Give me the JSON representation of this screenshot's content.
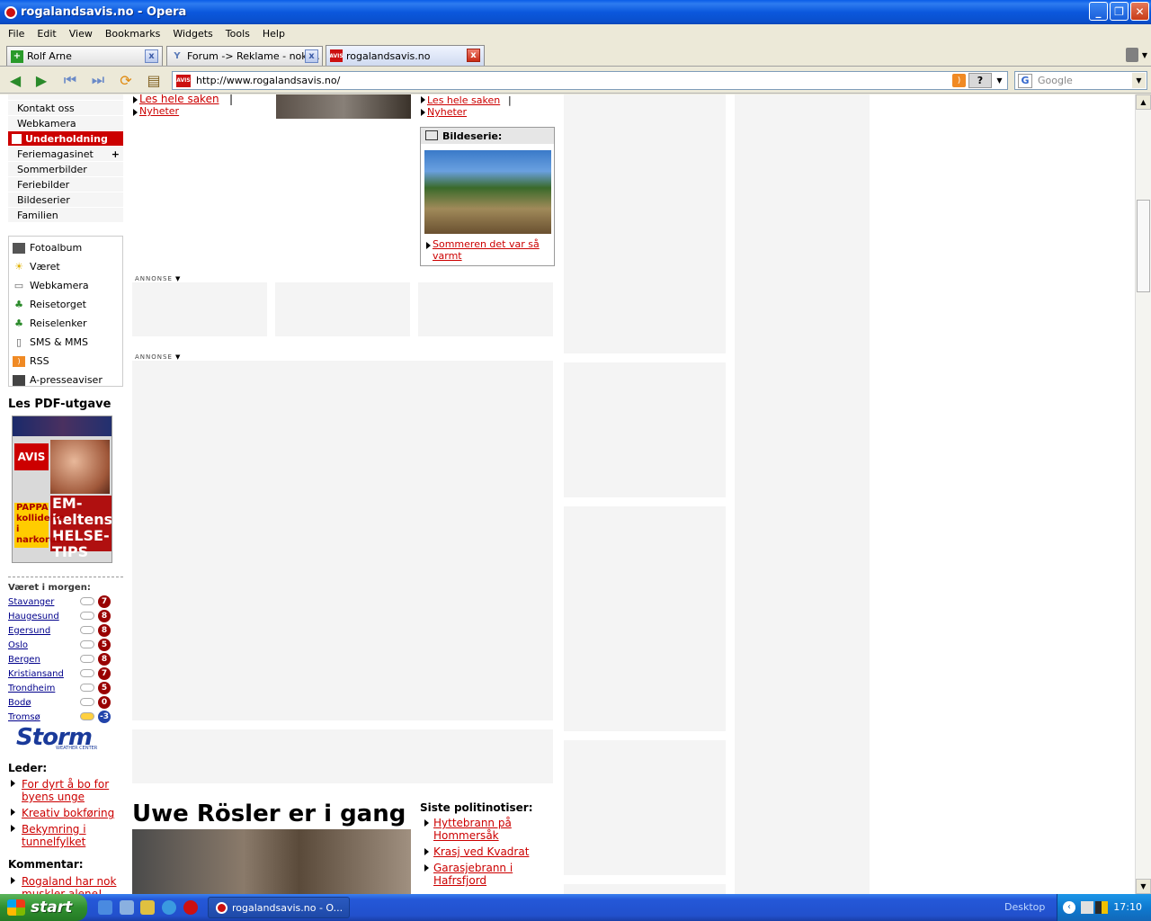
{
  "window": {
    "title": "rogalandsavis.no - Opera",
    "min_label": "_",
    "max_label": "❐",
    "close_label": "✕"
  },
  "menu": [
    "File",
    "Edit",
    "View",
    "Bookmarks",
    "Widgets",
    "Tools",
    "Help"
  ],
  "tabs": [
    {
      "label": "Rolf Arne",
      "icon": "plus-icon"
    },
    {
      "label": "Forum -> Reklame - nok ...",
      "icon": "forum-icon"
    },
    {
      "label": "rogalandsavis.no",
      "icon": "avis-icon"
    }
  ],
  "address": {
    "url": "http://www.rogalandsavis.no/",
    "site_icon_text": "AVIS",
    "search_placeholder": "Google",
    "help_label": "?"
  },
  "leftnav": {
    "top_items": [
      "Kontakt oss",
      "Webkamera"
    ],
    "section_head": "Underholdning",
    "section_items": [
      {
        "label": "Feriemagasinet",
        "has_plus": true
      },
      {
        "label": "Sommerbilder"
      },
      {
        "label": "Feriebilder"
      },
      {
        "label": "Bildeserier"
      },
      {
        "label": "Familien"
      }
    ],
    "plus_label": "+",
    "icon_items": [
      {
        "label": "Fotoalbum",
        "icon": "film-icon"
      },
      {
        "label": "Været",
        "icon": "sun-icon"
      },
      {
        "label": "Webkamera",
        "icon": "camera-icon"
      },
      {
        "label": "Reisetorget",
        "icon": "palm-icon"
      },
      {
        "label": "Reiselenker",
        "icon": "palm-icon"
      },
      {
        "label": "SMS & MMS",
        "icon": "phone-icon"
      },
      {
        "label": "RSS",
        "icon": "rss-icon"
      },
      {
        "label": "A-presseaviser",
        "icon": "newspaper-icon"
      }
    ],
    "pdf_title": "Les PDF-utgave",
    "pdf_cover": {
      "logo": "AVIS",
      "headline": "EM-heltens HELSE-TIPS",
      "sub": "PAPPA kolliderte i narkorus"
    },
    "weather_title": "Været i morgen:",
    "weather": [
      {
        "city": "Stavanger",
        "temp": "7"
      },
      {
        "city": "Haugesund",
        "temp": "8"
      },
      {
        "city": "Egersund",
        "temp": "8"
      },
      {
        "city": "Oslo",
        "temp": "5"
      },
      {
        "city": "Bergen",
        "temp": "8"
      },
      {
        "city": "Kristiansand",
        "temp": "7"
      },
      {
        "city": "Trondheim",
        "temp": "5"
      },
      {
        "city": "Bodø",
        "temp": "0"
      },
      {
        "city": "Tromsø",
        "temp": "-3"
      }
    ],
    "storm_logo": "Storm",
    "storm_sub": "WEATHER CENTER",
    "leder_title": "Leder:",
    "leder_links": [
      "For dyrt å bo for byens unge",
      "Kreativ bokføring",
      "Bekymring i tunnelfylket"
    ],
    "kommentar_title": "Kommentar:",
    "kommentar_links": [
      "Rogaland har nok muskler alene!"
    ]
  },
  "main": {
    "col1_links": [
      "Les hele saken",
      "Nyheter"
    ],
    "col2_links": [
      "Les hele saken",
      "Nyheter"
    ],
    "separator": "|",
    "bildeserie_title": "Bildeserie:",
    "bildeserie_link": "Sommeren det var så varmt",
    "annonse_label": "ANNONSE",
    "headline": "Uwe Rösler er i gang",
    "politi_title": "Siste politinotiser:",
    "politi_links": [
      "Hyttebrann på Hommersåk",
      "Krasj ved Kvadrat",
      "Garasjebrann i Hafrsfjord"
    ]
  },
  "taskbar": {
    "start_label": "start",
    "task_label": "rogalandsavis.no - O...",
    "desktop_label": "Desktop",
    "clock": "17:10"
  }
}
